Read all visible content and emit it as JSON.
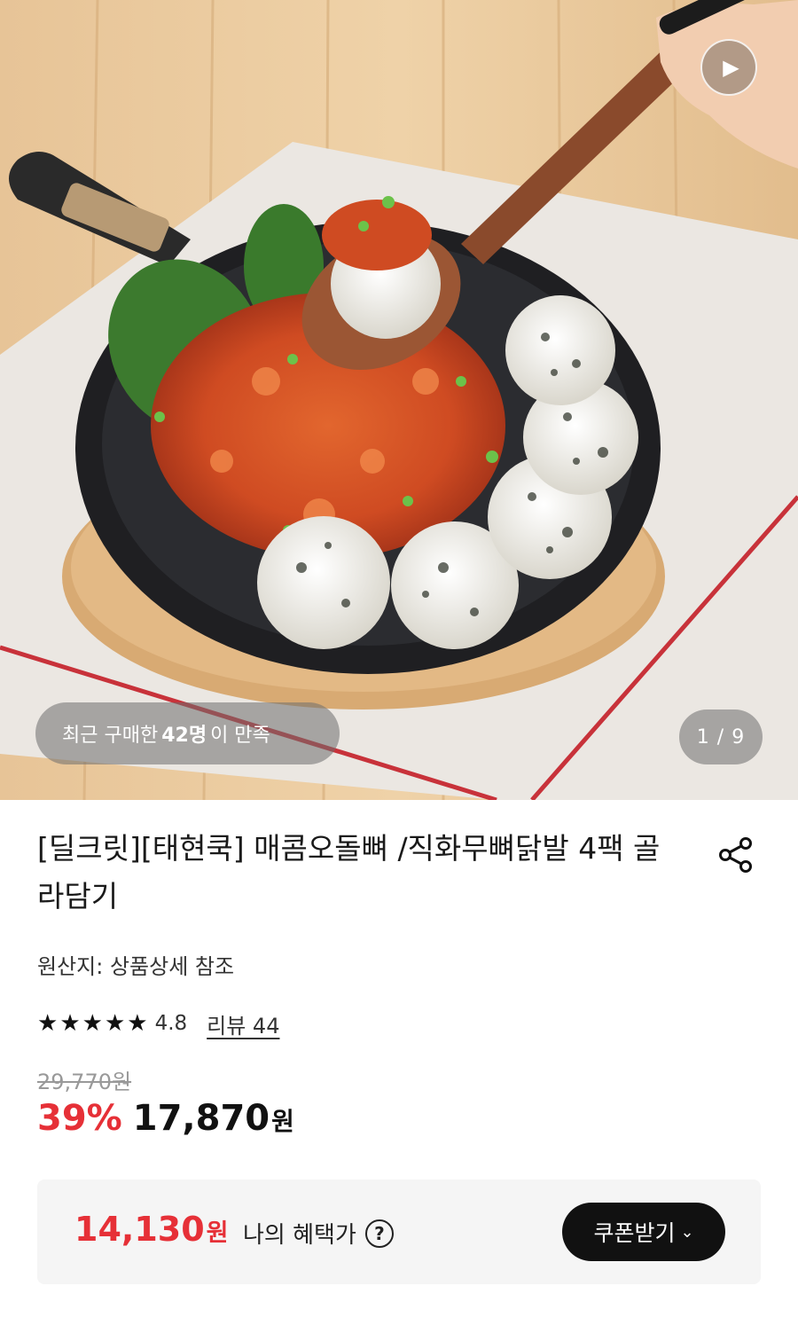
{
  "hero": {
    "buyers_prefix": "최근 구매한",
    "buyers_count": "42명",
    "buyers_suffix": "이 만족",
    "counter": "1 / 9",
    "play_icon": "play-icon"
  },
  "product": {
    "title": "[딜크릿][태현쿡] 매콤오돌뼈 /직화무뼈닭발 4팩 골라담기",
    "share_icon": "share-icon",
    "origin": "원산지: 상품상세 참조",
    "rating": {
      "stars": 5,
      "value": "4.8",
      "review_label": "리뷰 44"
    },
    "original_price": "29,770원",
    "discount": "39%",
    "sale_price": "17,870",
    "currency": "원"
  },
  "benefit": {
    "price": "14,130",
    "currency": "원",
    "label": "나의 혜택가",
    "help_icon": "?",
    "coupon_label": "쿠폰받기",
    "coupon_chevron": "⌄"
  },
  "colors": {
    "accent_red": "#e63037",
    "dark_button": "#111111",
    "benefit_bg": "#f5f5f5"
  }
}
